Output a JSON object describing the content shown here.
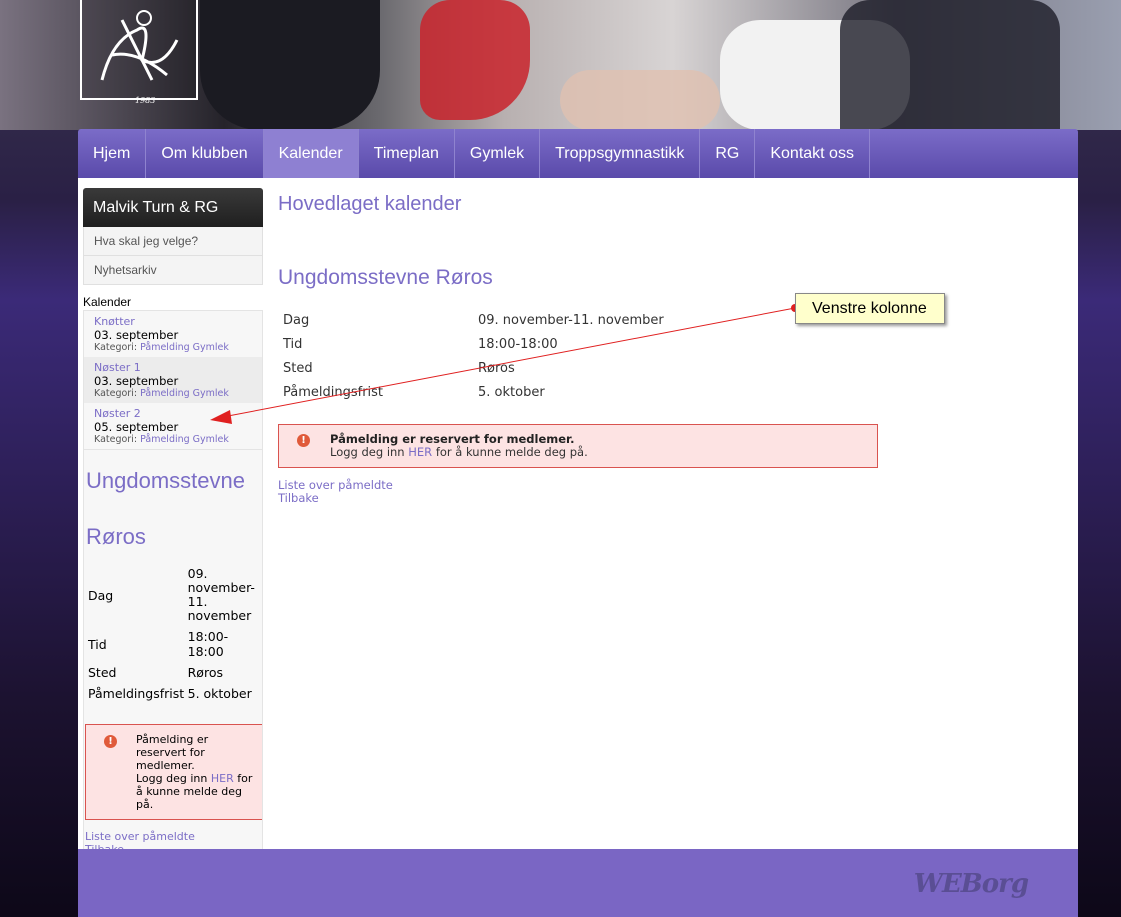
{
  "banner": {
    "logo_year": "1983"
  },
  "nav": {
    "items": [
      "Hjem",
      "Om klubben",
      "Kalender",
      "Timeplan",
      "Gymlek",
      "Troppsgymnastikk",
      "RG",
      "Kontakt oss"
    ],
    "active": "Kalender"
  },
  "sidebar": {
    "heading": "Malvik Turn & RG",
    "links": [
      "Hva skal jeg velge?",
      "Nyhetsarkiv"
    ],
    "kalender_heading": "Kalender",
    "events": [
      {
        "title": "Knøtter",
        "date": "03. september",
        "cat_label": "Kategori:",
        "cat": "Påmelding Gymlek"
      },
      {
        "title": "Nøster 1",
        "date": "03. september",
        "cat_label": "Kategori:",
        "cat": "Påmelding Gymlek"
      },
      {
        "title": "Nøster 2",
        "date": "05. september",
        "cat_label": "Kategori:",
        "cat": "Påmelding Gymlek"
      }
    ],
    "event_title_line1": "Ungdomsstevne",
    "event_title_line2": "Røros",
    "rows": {
      "dag_label": "Dag",
      "dag_value": "09. november-11. november",
      "tid_label": "Tid",
      "tid_value": "18:00-18:00",
      "sted_label": "Sted",
      "sted_value": "Røros",
      "frist_label": "Påmeldingsfrist",
      "frist_value": "5. oktober"
    },
    "alert_line1": "Påmelding er reservert for medlemer.",
    "alert_pre": "Logg deg inn ",
    "alert_link": "HER",
    "alert_post": " for å kunne melde deg på.",
    "list_link": "Liste over påmeldte",
    "back_link": "Tilbake"
  },
  "content": {
    "page_title": "Hovedlaget kalender",
    "event_title": "Ungdomsstevne Røros",
    "info": [
      {
        "label": "Dag",
        "value": "09. november-11. november"
      },
      {
        "label": "Tid",
        "value": "18:00-18:00"
      },
      {
        "label": "Sted",
        "value": "Røros"
      },
      {
        "label": "Påmeldingsfrist",
        "value": "5. oktober"
      }
    ],
    "alert_title": "Påmelding er reservert for medlemer.",
    "alert_pre": "Logg deg inn ",
    "alert_link": "HER",
    "alert_post": " for å kunne melde deg på.",
    "list_link": "Liste over påmeldte",
    "back_link": "Tilbake"
  },
  "annotation": {
    "label": "Venstre kolonne",
    "color": "#e02020"
  },
  "footer": {
    "brand": "WEBorg"
  },
  "colors": {
    "accent": "#7b6dc6",
    "nav": "#5a4aaa",
    "footer": "#7a66c4",
    "alert_bg": "#fde3e3",
    "alert_border": "#d9534f"
  }
}
